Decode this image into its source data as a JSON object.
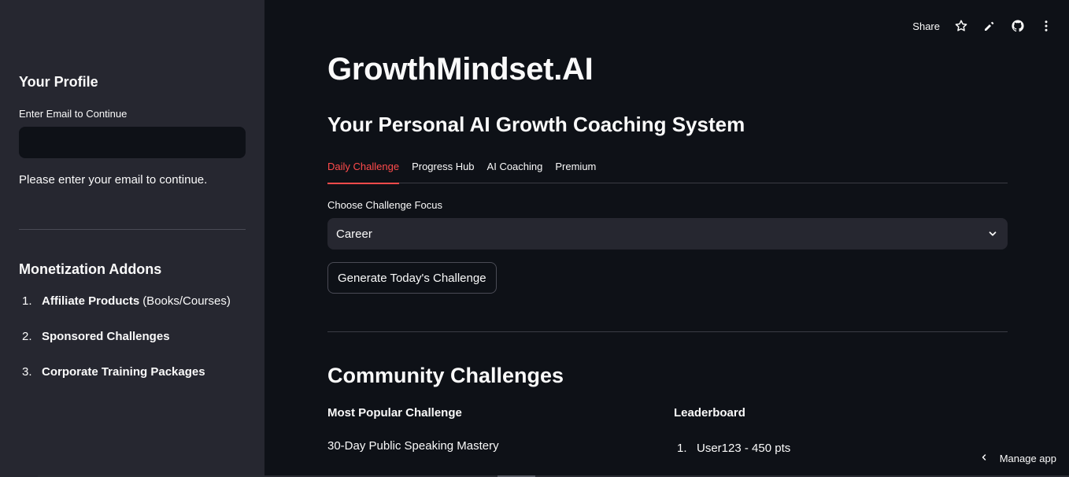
{
  "sidebar": {
    "profile_heading": "Your Profile",
    "email_label": "Enter Email to Continue",
    "email_value": "",
    "info_text": "Please enter your email to continue.",
    "addons_heading": "Monetization Addons",
    "addons": [
      {
        "num": "1.",
        "bold": "Affiliate Products",
        "rest": "(Books/Courses)"
      },
      {
        "num": "2.",
        "bold": "Sponsored Challenges",
        "rest": ""
      },
      {
        "num": "3.",
        "bold": "Corporate Training Packages",
        "rest": ""
      }
    ]
  },
  "toolbar": {
    "share_label": "Share",
    "icons": [
      "star-icon",
      "pencil-icon",
      "github-icon",
      "more-vertical-icon"
    ]
  },
  "main": {
    "title": "GrowthMindset.AI",
    "subtitle": "Your Personal AI Growth Coaching System",
    "tabs": [
      {
        "label": "Daily Challenge",
        "active": true
      },
      {
        "label": "Progress Hub",
        "active": false
      },
      {
        "label": "AI Coaching",
        "active": false
      },
      {
        "label": "Premium",
        "active": false
      }
    ],
    "select_label": "Choose Challenge Focus",
    "select_value": "Career",
    "generate_button": "Generate Today's Challenge",
    "community_heading": "Community Challenges",
    "popular_heading": "Most Popular Challenge",
    "popular_value": "30-Day Public Speaking Mastery",
    "leaderboard_heading": "Leaderboard",
    "leaderboard": [
      {
        "num": "1.",
        "text": "User123 - 450 pts"
      }
    ]
  },
  "footer": {
    "manage_label": "Manage app"
  },
  "colors": {
    "background": "#0e1117",
    "sidebar": "#262730",
    "accent": "#ff4b4b",
    "text": "#fafafa"
  }
}
